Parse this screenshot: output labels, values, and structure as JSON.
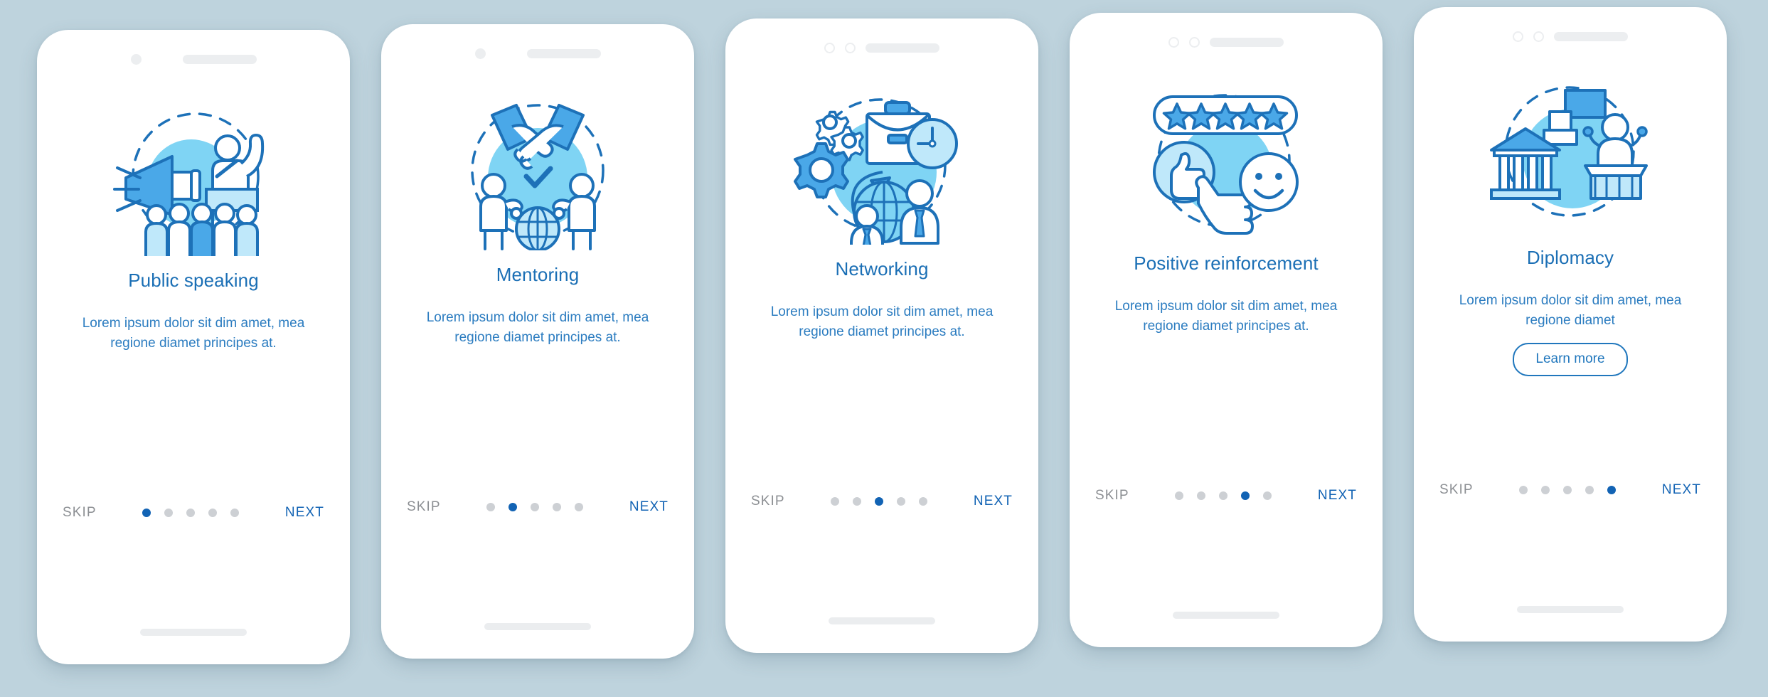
{
  "background_color": "#bed3dd",
  "colors": {
    "title_blue": "#1b6fb5",
    "body_blue": "#2b7cc0",
    "next_blue": "#1263b4",
    "skip_gray": "#8c8f93",
    "dot_inactive": "#cdd0d4",
    "art_fill_light": "#7fd4f4",
    "art_stroke": "#1d71b8",
    "art_fill_mid": "#4aa8e8",
    "art_fill_pale": "#bfe8fa",
    "card_white": "#ffffff",
    "statusbar_gray": "#eceef0"
  },
  "screens": [
    {
      "id": "public-speaking",
      "statusbar": {
        "style": "single-dot",
        "indicators": [
          "camera-dot",
          "speaker-pill"
        ]
      },
      "illustration": "public-speaking-icon",
      "title": "Public speaking",
      "description": "Lorem ipsum dolor sit dim amet, mea regione diamet principes at.",
      "skip_label": "SKIP",
      "next_label": "NEXT",
      "dots_total": 5,
      "dots_active_index": 0,
      "has_learn_more": false,
      "learn_more_label": ""
    },
    {
      "id": "mentoring",
      "statusbar": {
        "style": "single-dot",
        "indicators": [
          "camera-dot",
          "speaker-pill"
        ]
      },
      "illustration": "mentoring-icon",
      "title": "Mentoring",
      "description": "Lorem ipsum dolor sit dim amet, mea regione diamet principes at.",
      "skip_label": "SKIP",
      "next_label": "NEXT",
      "dots_total": 5,
      "dots_active_index": 1,
      "has_learn_more": false,
      "learn_more_label": ""
    },
    {
      "id": "networking",
      "statusbar": {
        "style": "double-ring",
        "indicators": [
          "camera-ring",
          "sensor-ring",
          "speaker-pill"
        ]
      },
      "illustration": "networking-icon",
      "title": "Networking",
      "description": "Lorem ipsum dolor sit dim amet, mea regione diamet principes at.",
      "skip_label": "SKIP",
      "next_label": "NEXT",
      "dots_total": 5,
      "dots_active_index": 2,
      "has_learn_more": false,
      "learn_more_label": ""
    },
    {
      "id": "positive-reinforcement",
      "statusbar": {
        "style": "double-ring",
        "indicators": [
          "camera-ring",
          "sensor-ring",
          "speaker-pill"
        ]
      },
      "illustration": "positive-reinforcement-icon",
      "title": "Positive reinforcement",
      "description": "Lorem ipsum dolor sit dim amet, mea regione diamet principes at.",
      "skip_label": "SKIP",
      "next_label": "NEXT",
      "dots_total": 5,
      "dots_active_index": 3,
      "has_learn_more": false,
      "learn_more_label": ""
    },
    {
      "id": "diplomacy",
      "statusbar": {
        "style": "double-ring",
        "indicators": [
          "camera-ring",
          "sensor-ring",
          "speaker-pill"
        ]
      },
      "illustration": "diplomacy-icon",
      "title": "Diplomacy",
      "description": "Lorem ipsum dolor sit dim amet, mea regione diamet",
      "skip_label": "SKIP",
      "next_label": "NEXT",
      "dots_total": 5,
      "dots_active_index": 4,
      "has_learn_more": true,
      "learn_more_label": "Learn more"
    }
  ]
}
